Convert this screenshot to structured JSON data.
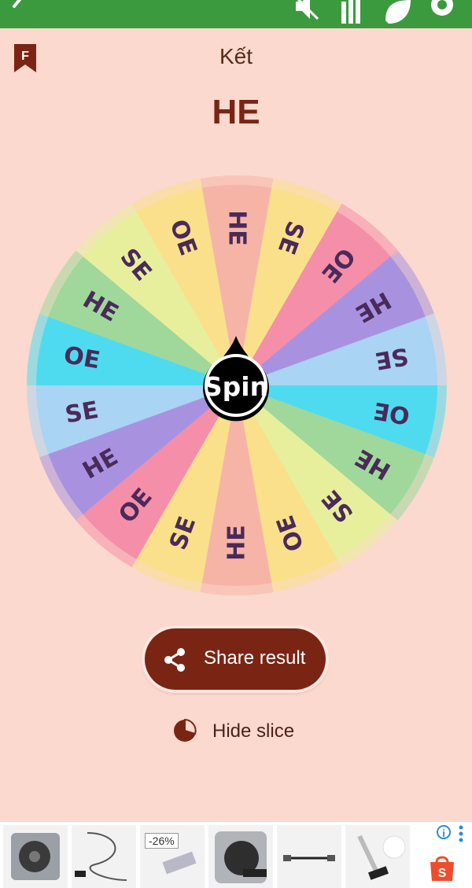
{
  "header": {
    "icons": [
      "back-icon",
      "mute-icon",
      "stats-icon",
      "theme-icon",
      "settings-icon"
    ],
    "color": "#3b9a3e"
  },
  "result": {
    "label": "Kết",
    "value": "HE"
  },
  "wheel": {
    "slices": [
      {
        "label": "HE",
        "color": "#f6b4a6"
      },
      {
        "label": "SE",
        "color": "#fae08a"
      },
      {
        "label": "OE",
        "color": "#f58ea8"
      },
      {
        "label": "HE",
        "color": "#a892e0"
      },
      {
        "label": "SE",
        "color": "#a9d4f4"
      },
      {
        "label": "OE",
        "color": "#4fdbef"
      },
      {
        "label": "HE",
        "color": "#9fd89a"
      },
      {
        "label": "SE",
        "color": "#e7ef9c"
      },
      {
        "label": "OE",
        "color": "#fae08a"
      },
      {
        "label": "HE",
        "color": "#f6b4a6"
      },
      {
        "label": "SE",
        "color": "#fae08a"
      },
      {
        "label": "OE",
        "color": "#f58ea8"
      },
      {
        "label": "HE",
        "color": "#a892e0"
      },
      {
        "label": "SE",
        "color": "#a9d4f4"
      },
      {
        "label": "OE",
        "color": "#4fdbef"
      },
      {
        "label": "HE",
        "color": "#9fd89a"
      },
      {
        "label": "SE",
        "color": "#e7ef9c"
      },
      {
        "label": "OE",
        "color": "#fae08a"
      }
    ],
    "text_color": "#4a2a5a"
  },
  "spin": {
    "label": "Spin"
  },
  "share": {
    "label": "Share result",
    "icon": "share-icon"
  },
  "hide_slice": {
    "label": "Hide slice",
    "icon": "pie-chart-icon"
  },
  "ads": {
    "items": [
      "laptop-fan",
      "cable",
      "cable-discount",
      "laptop-fan",
      "cable",
      "cable"
    ],
    "discount": "-26%",
    "info_icon": "info-icon",
    "menu_icon": "more-vert-icon",
    "store_icon": "shopee-icon"
  }
}
